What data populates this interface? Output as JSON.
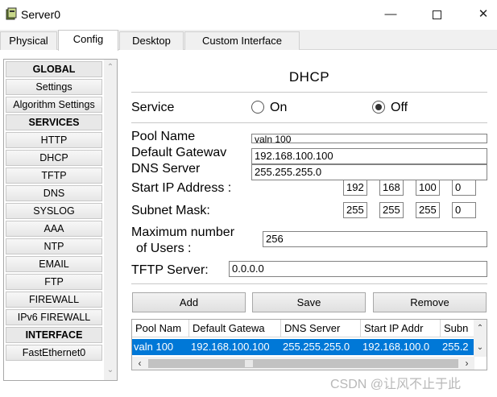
{
  "window": {
    "title": "Server0",
    "icon": "server-icon",
    "controls": {
      "minimize": "—",
      "close": "✕"
    }
  },
  "tabs": [
    {
      "label": "Physical",
      "active": false
    },
    {
      "label": "Config",
      "active": true
    },
    {
      "label": "Desktop",
      "active": false
    },
    {
      "label": "Custom Interface",
      "active": false
    }
  ],
  "sidebar": {
    "sections": {
      "global": "GLOBAL",
      "services": "SERVICES",
      "interface": "INTERFACE"
    },
    "global_items": [
      "Settings",
      "Algorithm Settings"
    ],
    "service_items": [
      "HTTP",
      "DHCP",
      "TFTP",
      "DNS",
      "SYSLOG",
      "AAA",
      "NTP",
      "EMAIL",
      "FTP",
      "FIREWALL",
      "IPv6 FIREWALL"
    ],
    "interface_items": [
      "FastEthernet0"
    ]
  },
  "dhcp": {
    "heading": "DHCP",
    "service_label": "Service",
    "on_label": "On",
    "off_label": "Off",
    "selected": "Off",
    "pool_name_label": "Pool Name",
    "pool_name_value": "valn 100",
    "gateway_label": "Default Gatewav",
    "gateway_value": "192.168.100.100",
    "dns_label": "DNS Server",
    "dns_value": "255.255.255.0",
    "start_ip_label": "Start IP Address :",
    "start_ip": [
      "192",
      "168",
      "100",
      "0"
    ],
    "subnet_label": "Subnet Mask:",
    "subnet": [
      "255",
      "255",
      "255",
      "0"
    ],
    "max_users_label_1": "Maximum number",
    "max_users_label_2": "of Users :",
    "max_users_value": "256",
    "tftp_label": "TFTP Server:",
    "tftp_value": "0.0.0.0",
    "buttons": {
      "add": "Add",
      "save": "Save",
      "remove": "Remove"
    }
  },
  "table": {
    "columns": [
      "Pool Nam",
      "Default Gatewa",
      "DNS Server",
      "Start IP Addr",
      "Subn"
    ],
    "rows": [
      [
        "valn 100",
        "192.168.100.100",
        "255.255.255.0",
        "192.168.100.0",
        "255.2"
      ]
    ],
    "selected_color": "#0078d7"
  },
  "watermark": "CSDN @让风不止于此"
}
